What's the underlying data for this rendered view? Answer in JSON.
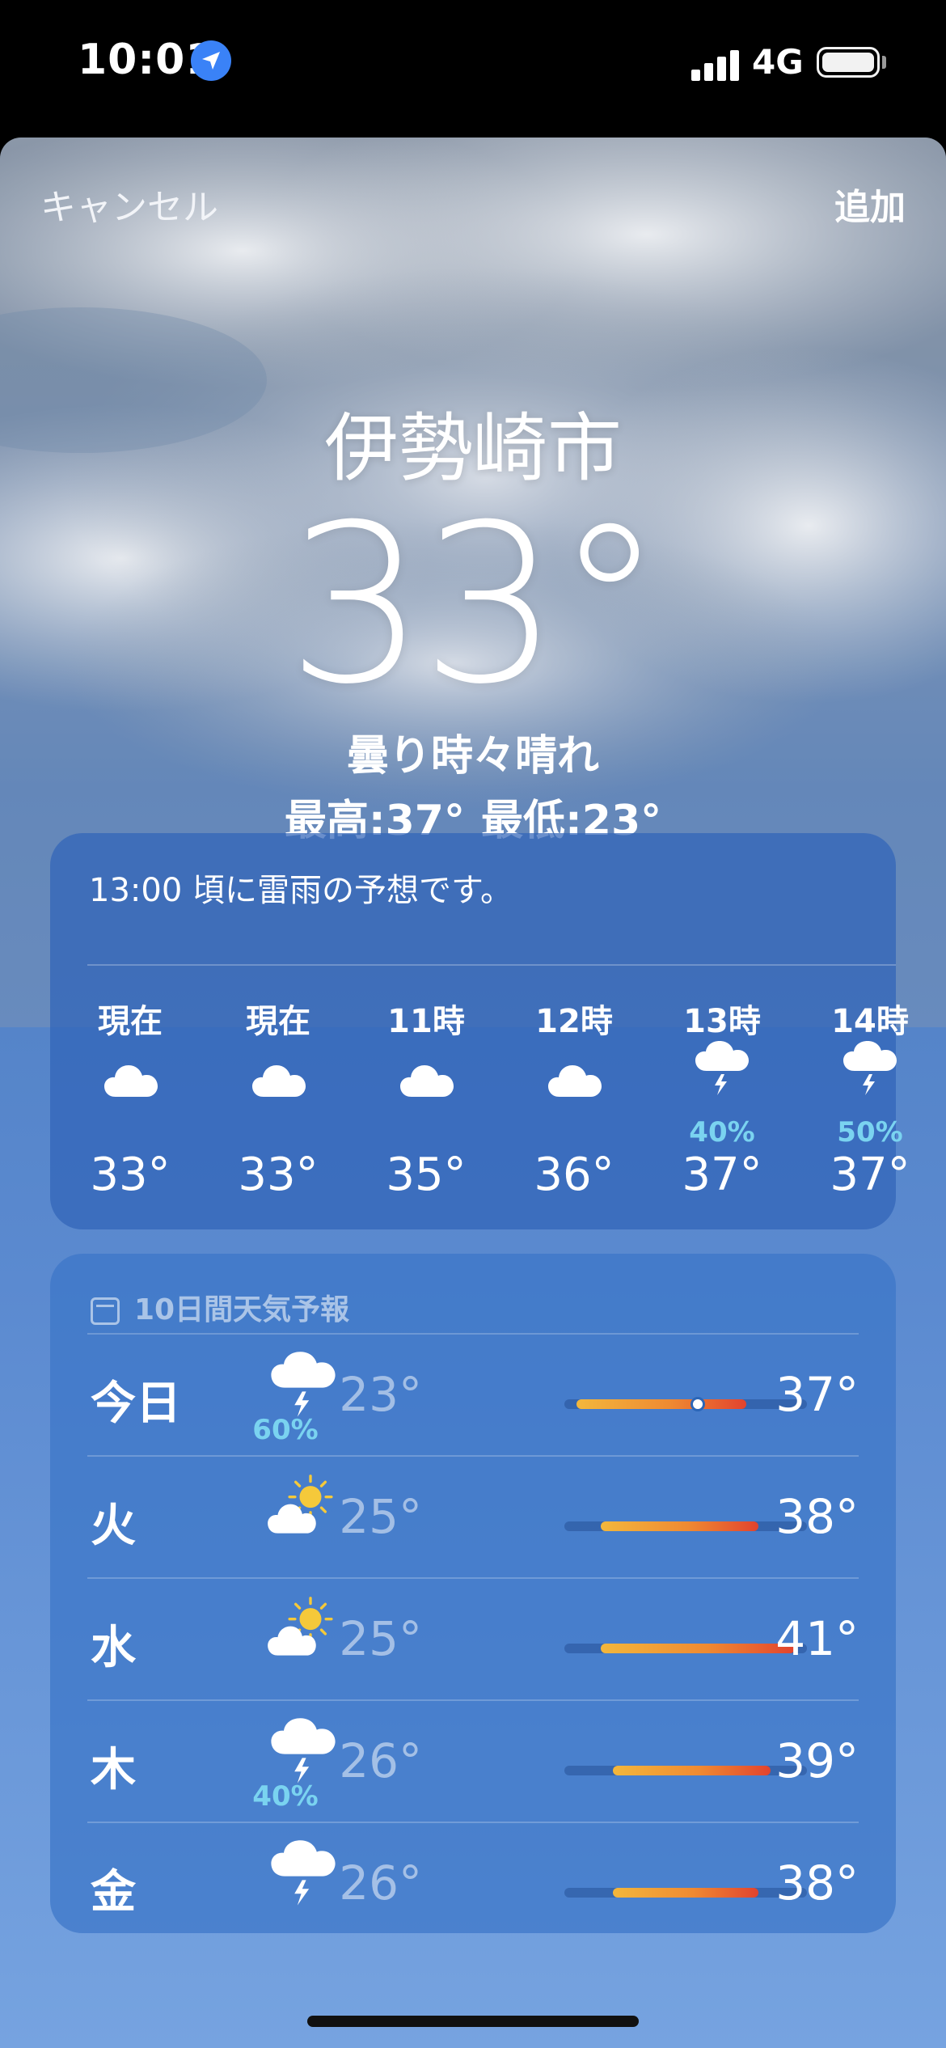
{
  "status_bar": {
    "time": "10:01",
    "network": "4G"
  },
  "nav": {
    "cancel_label": "キャンセル",
    "add_label": "追加"
  },
  "current": {
    "city": "伊勢崎市",
    "temperature": "33°",
    "condition": "曇り時々晴れ",
    "high": "最高:37°",
    "low": "最低:23°"
  },
  "hourly": {
    "summary": "13:00 頃に雷雨の予想です。",
    "items": [
      {
        "label": "現在",
        "icon": "cloud-icon",
        "precip": "",
        "temp": "33°"
      },
      {
        "label": "現在",
        "icon": "cloud-icon",
        "precip": "",
        "temp": "33°"
      },
      {
        "label": "11時",
        "icon": "cloud-icon",
        "precip": "",
        "temp": "35°"
      },
      {
        "label": "12時",
        "icon": "cloud-icon",
        "precip": "",
        "temp": "36°"
      },
      {
        "label": "13時",
        "icon": "thunderstorm-icon",
        "precip": "40%",
        "temp": "37°"
      },
      {
        "label": "14時",
        "icon": "thunderstorm-icon",
        "precip": "50%",
        "temp": "37°"
      }
    ]
  },
  "daily": {
    "header": "10日間天気予報",
    "range_min": 22,
    "range_max": 42,
    "days": [
      {
        "day": "今日",
        "icon": "thunderstorm-icon",
        "precip": "60%",
        "low": "23°",
        "high": "37°",
        "low_val": 23,
        "high_val": 37,
        "current_val": 33
      },
      {
        "day": "火",
        "icon": "partly-sunny-icon",
        "precip": "",
        "low": "25°",
        "high": "38°",
        "low_val": 25,
        "high_val": 38
      },
      {
        "day": "水",
        "icon": "partly-sunny-icon",
        "precip": "",
        "low": "25°",
        "high": "41°",
        "low_val": 25,
        "high_val": 41
      },
      {
        "day": "木",
        "icon": "thunderstorm-icon",
        "precip": "40%",
        "low": "26°",
        "high": "39°",
        "low_val": 26,
        "high_val": 39
      },
      {
        "day": "金",
        "icon": "thunderstorm-icon",
        "precip": "",
        "low": "26°",
        "high": "38°",
        "low_val": 26,
        "high_val": 38
      }
    ]
  }
}
